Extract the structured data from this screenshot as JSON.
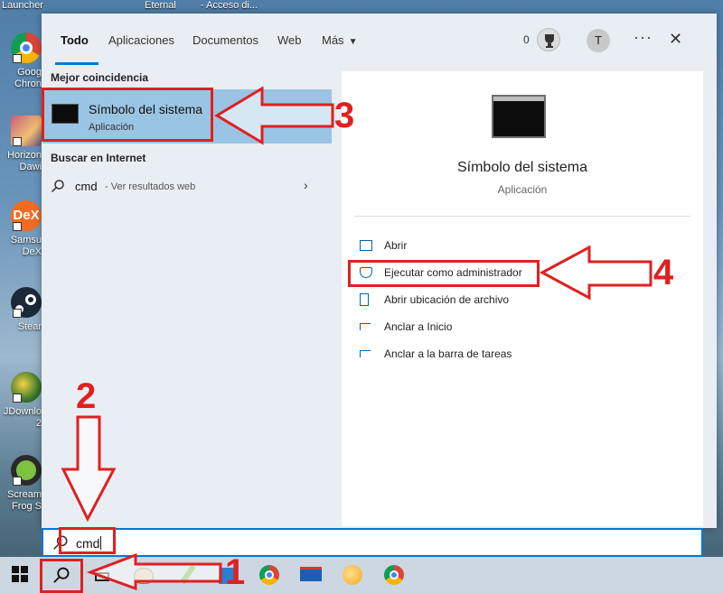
{
  "desktop": {
    "top_labels": [
      "Launcher",
      "Eternal",
      "- Acceso di..."
    ],
    "icons": [
      {
        "label": "Goog\nChron",
        "icon": "chrome-icon"
      },
      {
        "label": "Horizon\nDawi",
        "icon": "game-icon"
      },
      {
        "label": "Samsu\nDeX",
        "icon": "dex-icon"
      },
      {
        "label": "Stear",
        "icon": "steam-icon"
      },
      {
        "label": "JDownlo\n2",
        "icon": "jdownloader-icon"
      },
      {
        "label": "Scream\nFrog S",
        "icon": "frog-icon"
      }
    ]
  },
  "start_menu": {
    "tabs": [
      {
        "label": "Todo",
        "active": true
      },
      {
        "label": "Aplicaciones",
        "active": false
      },
      {
        "label": "Documentos",
        "active": false
      },
      {
        "label": "Web",
        "active": false
      },
      {
        "label": "Más",
        "active": false
      }
    ],
    "points": "0",
    "avatar_initial": "T",
    "more_label": "···",
    "close_label": "✕",
    "best_match_heading": "Mejor coincidencia",
    "best_match": {
      "title": "Símbolo del sistema",
      "subtitle": "Aplicación"
    },
    "web_heading": "Buscar en Internet",
    "web_result": {
      "query": "cmd",
      "suffix": "- Ver resultados web"
    },
    "detail": {
      "title": "Símbolo del sistema",
      "subtitle": "Aplicación",
      "actions": [
        {
          "label": "Abrir",
          "icon": "open-icon"
        },
        {
          "label": "Ejecutar como administrador",
          "icon": "admin-shield-icon"
        },
        {
          "label": "Abrir ubicación de archivo",
          "icon": "file-location-icon"
        },
        {
          "label": "Anclar a Inicio",
          "icon": "pin-icon"
        },
        {
          "label": "Anclar a la barra de tareas",
          "icon": "pin-icon"
        }
      ]
    }
  },
  "search": {
    "value": "cmd"
  },
  "taskbar": {
    "items": [
      "windows-start",
      "search",
      "task-view",
      "paint",
      "pen-app",
      "store",
      "chrome",
      "remote-desktop",
      "edge-canary",
      "chrome-alt"
    ]
  },
  "annotations": {
    "steps": [
      "1",
      "2",
      "3",
      "4"
    ],
    "color": "#e02020"
  },
  "colors": {
    "accent": "#0078d4",
    "selection": "#9ac4e3",
    "annotation": "#e02020"
  }
}
